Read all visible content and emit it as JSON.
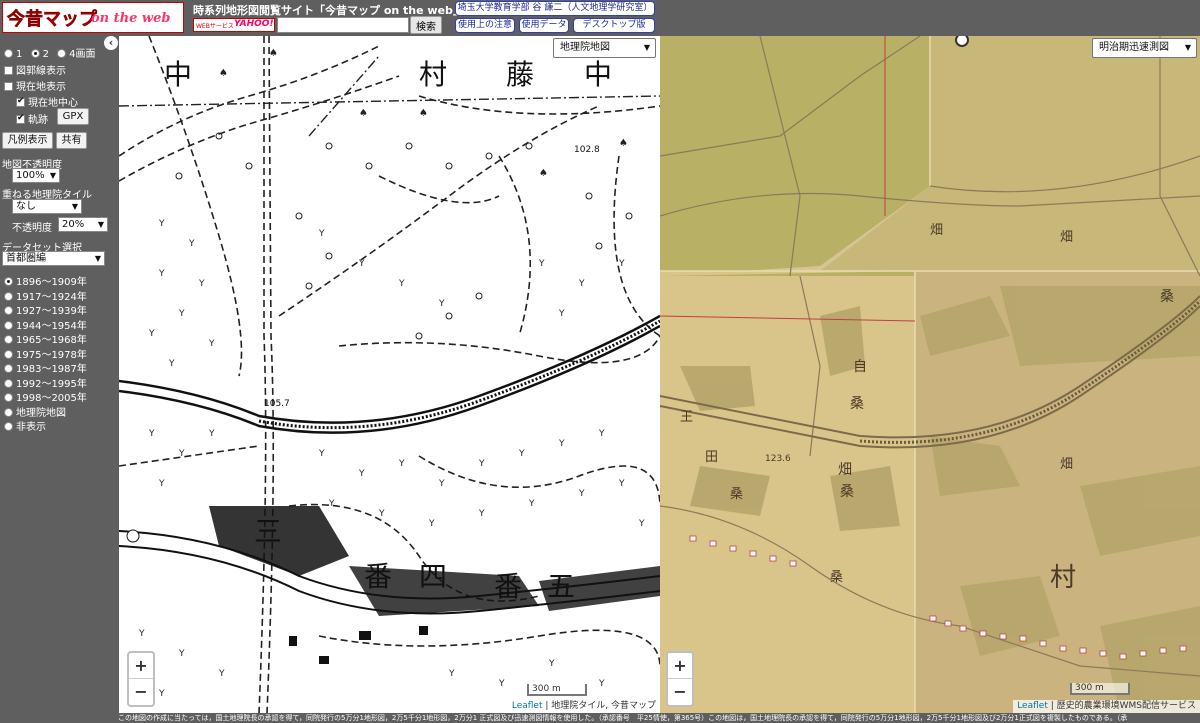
{
  "header": {
    "logo_main": "今昔マップ",
    "logo_sub": "on the web",
    "site_title": "時系列地形図閲覧サイト「今昔マップ on the web」",
    "web_service_badge": "WEBサービス",
    "yahoo_badge": "YAHOO!",
    "search_value": "",
    "search_button": "検索",
    "author_button": "埼玉大学教育学部 谷 謙二（人文地理学研究室）",
    "notes_button": "使用上の注意",
    "data_button": "使用データ",
    "desktop_button": "デスクトップ版"
  },
  "sidebar": {
    "collapse_icon": "‹",
    "screen_options": [
      "1",
      "2",
      "4画面"
    ],
    "screen_selected": "2",
    "show_grid": "図郭線表示",
    "show_current": "現在地表示",
    "center_current": "現在地中心",
    "track": "軌跡",
    "gpx_button": "GPX",
    "legend_button": "凡例表示",
    "share_button": "共有",
    "opacity_label": "地図不透明度",
    "opacity_value": "100%",
    "overlay_label": "重ねる地理院タイル",
    "overlay_value": "なし",
    "overlay_opacity_label": "不透明度",
    "overlay_opacity_value": "20%",
    "dataset_label": "データセット選択",
    "dataset_value": "首都圏編",
    "periods": [
      "1896～1909年",
      "1917～1924年",
      "1927～1939年",
      "1944～1954年",
      "1965～1968年",
      "1975～1978年",
      "1983～1987年",
      "1992～1995年",
      "1998～2005年",
      "地理院地図",
      "非表示"
    ],
    "period_selected": 0
  },
  "map_left": {
    "layer": "地理院地図",
    "zoom_in": "+",
    "zoom_out": "−",
    "scale": "300 m",
    "attribution_leaflet": "Leaflet",
    "attribution_rest": " | 地理院タイル, 今昔マップ",
    "labels": [
      "中",
      "村",
      "藤",
      "中",
      "三",
      "番",
      "四",
      "番",
      "五",
      "102.8",
      "105.7"
    ]
  },
  "map_right": {
    "layer": "明治期迅速測図",
    "zoom_in": "+",
    "zoom_out": "−",
    "scale": "300 m",
    "attribution_leaflet": "Leaflet",
    "attribution_rest": " | 歴史的農業環境WMS配信サービス",
    "labels": [
      "畑",
      "畑",
      "桑",
      "自",
      "桑",
      "畑",
      "桑",
      "村",
      "畑",
      "123.6",
      "王",
      "田",
      "桑",
      "桑"
    ]
  },
  "footer": {
    "text": "この地図の作成に当たっては，国土地理院長の承認を得て，同院発行の5万分1地形図，2万5千分1地形図，2万分1 正式図及び迅速測図情報を使用した。（承認番号　平25情使，第365号）この地図は，国土地理院長の承認を得て，同院発行の5万分1地形図，2万5千分1地形図及び2万分1正式図を複製したものである。（承"
  },
  "colors": {
    "chrome_gray": "#5f5f5f",
    "logo_red": "#ee0000",
    "link_blue": "#1a2a9a",
    "old_map_tan": "#d2c08a",
    "old_map_olive": "#b5ad5c"
  }
}
